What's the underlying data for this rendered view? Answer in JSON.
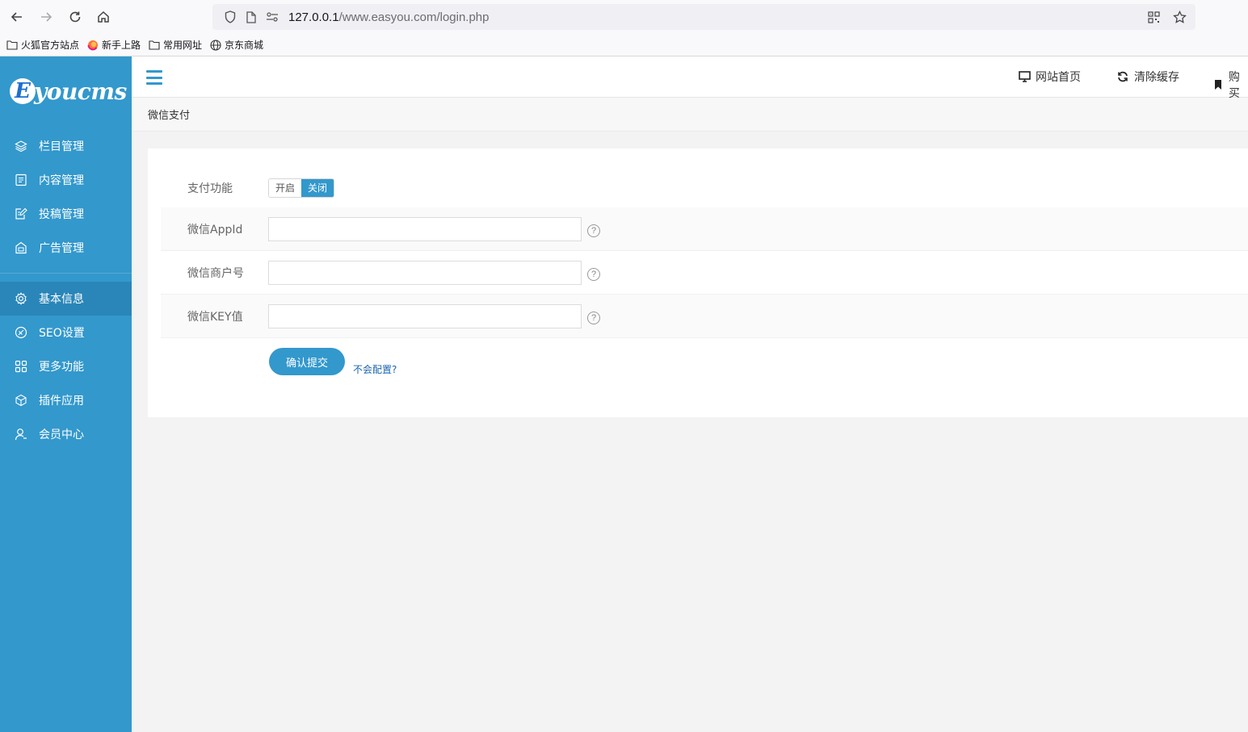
{
  "browser": {
    "url_host": "127.0.0.1",
    "url_path": "/www.easyou.com/login.php",
    "bookmarks": [
      "火狐官方站点",
      "新手上路",
      "常用网址",
      "京东商城"
    ]
  },
  "sidebar": {
    "logo_letter": "E",
    "logo_text": "youcms",
    "group1": [
      {
        "label": "栏目管理",
        "icon": "layers-icon"
      },
      {
        "label": "内容管理",
        "icon": "document-icon"
      },
      {
        "label": "投稿管理",
        "icon": "edit-icon"
      },
      {
        "label": "广告管理",
        "icon": "ad-icon"
      }
    ],
    "group2": [
      {
        "label": "基本信息",
        "icon": "gear-icon",
        "active": true
      },
      {
        "label": "SEO设置",
        "icon": "seo-icon"
      },
      {
        "label": "更多功能",
        "icon": "grid-icon"
      },
      {
        "label": "插件应用",
        "icon": "cube-icon"
      },
      {
        "label": "会员中心",
        "icon": "user-icon"
      }
    ]
  },
  "topbar": {
    "links": [
      "网站首页",
      "清除缓存",
      "购买"
    ]
  },
  "breadcrumb": "微信支付",
  "form": {
    "pay_label": "支付功能",
    "switch_on": "开启",
    "switch_off": "关闭",
    "switch_state": "关闭",
    "appid_label": "微信AppId",
    "appid_value": "",
    "merchant_label": "微信商户号",
    "merchant_value": "",
    "key_label": "微信KEY值",
    "key_value": "",
    "help_glyph": "?",
    "submit_label": "确认提交",
    "help_link": "不会配置?"
  },
  "colors": {
    "primary": "#3398cc",
    "sidebar_active": "#2a86b9"
  }
}
